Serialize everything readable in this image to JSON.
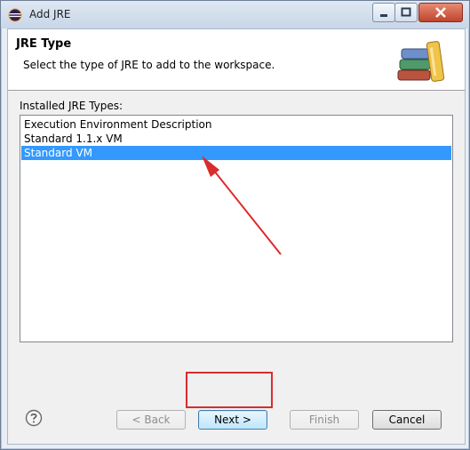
{
  "window": {
    "title": "Add JRE"
  },
  "header": {
    "heading": "JRE Type",
    "subtitle": "Select the type of JRE to add to the workspace."
  },
  "jre_list": {
    "label": "Installed JRE Types:",
    "items": [
      {
        "label": "Execution Environment Description",
        "selected": false
      },
      {
        "label": "Standard 1.1.x VM",
        "selected": false
      },
      {
        "label": "Standard VM",
        "selected": true
      }
    ]
  },
  "buttons": {
    "back": "< Back",
    "next": "Next >",
    "finish": "Finish",
    "cancel": "Cancel"
  },
  "colors": {
    "selection": "#3399ff",
    "annotation_red": "#d92c2c"
  },
  "icons": [
    "eclipse-icon",
    "minimize-icon",
    "maximize-icon",
    "close-icon",
    "jre-library-icon",
    "help-icon"
  ]
}
